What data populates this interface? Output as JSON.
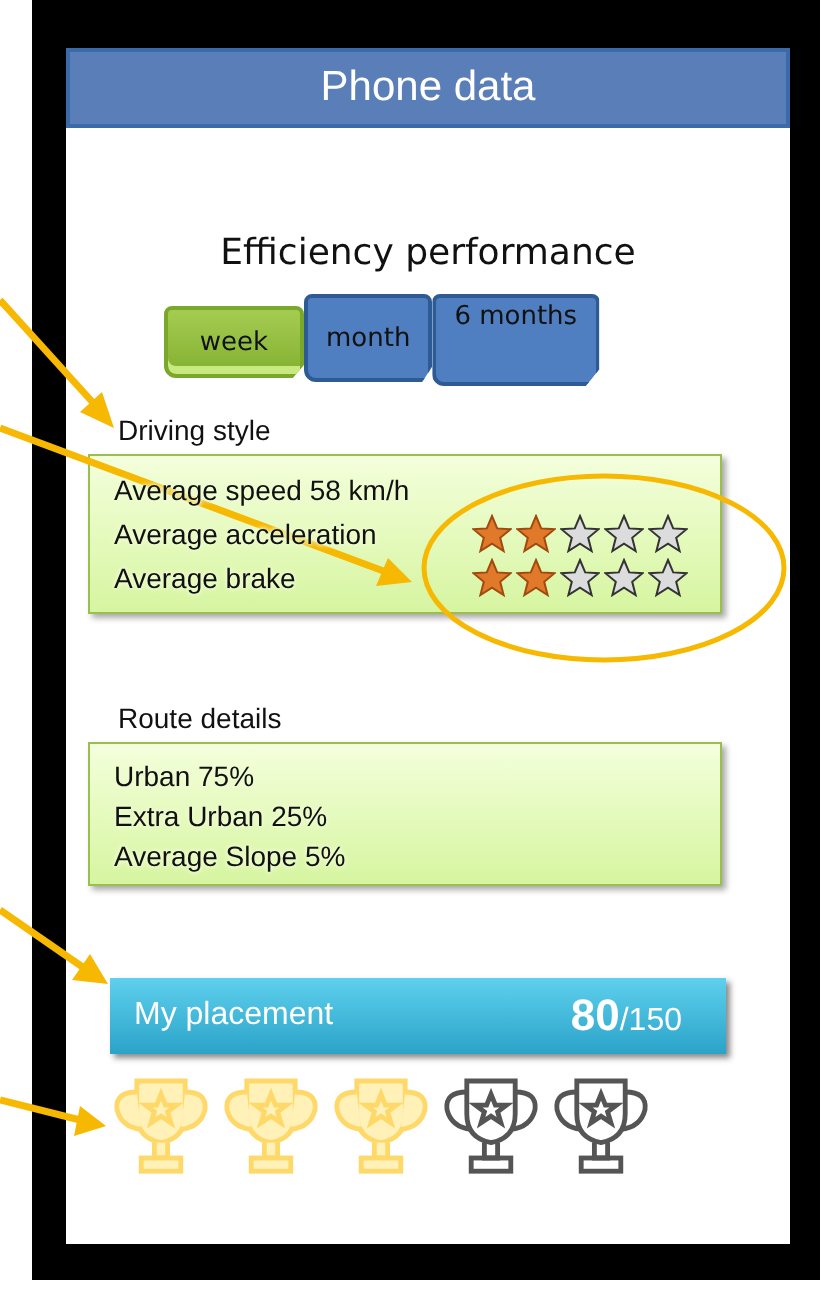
{
  "title": "Phone data",
  "heading": "Efficiency performance",
  "tabs": [
    {
      "label": "week",
      "selected": true
    },
    {
      "label": "month",
      "selected": false
    },
    {
      "label": "6 months",
      "selected": false
    }
  ],
  "driving_style": {
    "title": "Driving style",
    "rows": [
      {
        "label": "Average speed 58  km/h"
      },
      {
        "label": "Average acceleration",
        "stars": 2
      },
      {
        "label": "Average brake",
        "stars": 2
      }
    ]
  },
  "route_details": {
    "title": "Route details",
    "rows": [
      "Urban 75%",
      "Extra Urban 25%",
      "Average Slope  5%"
    ]
  },
  "placement": {
    "label": "My placement",
    "rank": "80",
    "total": "/150"
  },
  "trophies": {
    "stars": 3
  }
}
